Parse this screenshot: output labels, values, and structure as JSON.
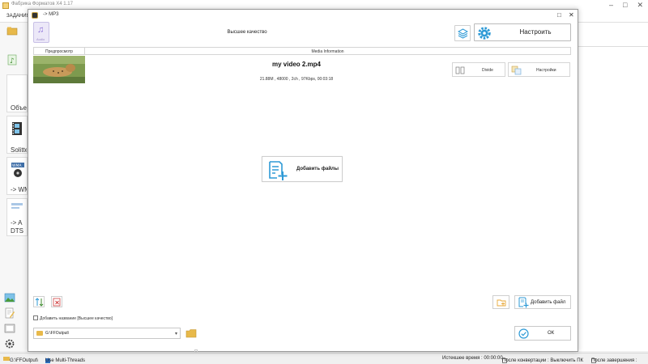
{
  "app": {
    "title": "Фабрика Форматов X4 1.17",
    "menu_label": "ЗАДАНИЯ"
  },
  "sidebar": {
    "items": [
      {
        "label": "Объед",
        "icon": "film-merge-icon"
      },
      {
        "label": "Solitter",
        "icon": "film-split-icon"
      },
      {
        "label": "-> WM",
        "icon": "wma-icon"
      },
      {
        "label": "-> A",
        "sub": "DTS",
        "icon": "audio-convert-icon"
      }
    ],
    "top_icons": [
      "folder-icon",
      "note-icon"
    ],
    "bottom_icons": [
      "image-icon",
      "edit-icon",
      "settings-icon",
      "gear-icon"
    ]
  },
  "dialog": {
    "title": "-> MP3",
    "format_icon_sub": "Audio",
    "quality_label": "Высшее качество",
    "configure_label": "Настроить",
    "table": {
      "col_preview": "Предпросмотр",
      "col_info": "Media Information"
    },
    "file": {
      "name": "my video 2.mp4",
      "meta": "21.88M , 48000 , 2ch , 97Kbps, 00:03:18",
      "divide_label": "Divide",
      "options_label": "Настройки"
    },
    "add_files_label": "Добавить файлы",
    "add_file_label": "Добавить файл",
    "add_name_label": "Добавить название [Высшее качество]",
    "output_path": "G:\\FFOutput\\",
    "ok_label": "ОК"
  },
  "status": {
    "output": "G:\\FFOutput\\",
    "multithread": "Use Multi-Threads",
    "elapsed": "Истекшее время : 00:00:00",
    "after_convert": "После конвертации : Выключить ПК",
    "after_done": "После завершения :"
  },
  "colors": {
    "accent": "#2e9ad6",
    "folder": "#e8b94a",
    "audio_icon": "#8a6fd8"
  }
}
